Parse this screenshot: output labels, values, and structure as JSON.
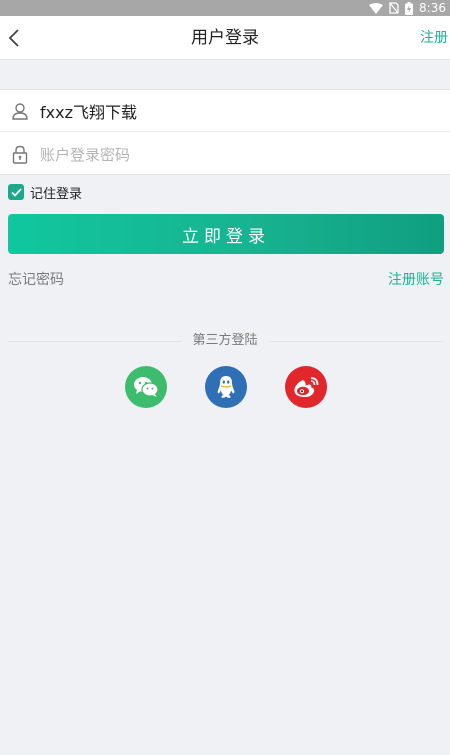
{
  "status_bar": {
    "time": "8:36"
  },
  "nav": {
    "title": "用户登录",
    "right_label": "注册"
  },
  "form": {
    "username_value": "fxxz飞翔下载",
    "password_placeholder": "账户登录密码"
  },
  "remember": {
    "label": "记住登录",
    "checked": true
  },
  "login_button": "立即登录",
  "links": {
    "forgot": "忘记密码",
    "register": "注册账号"
  },
  "third_party": {
    "title": "第三方登陆",
    "providers": [
      "wechat-icon",
      "qq-icon",
      "weibo-icon"
    ]
  },
  "colors": {
    "accent": "#1bb394",
    "wechat": "#3ebc6e",
    "qq": "#2f6fb5",
    "weibo": "#e1262c"
  }
}
